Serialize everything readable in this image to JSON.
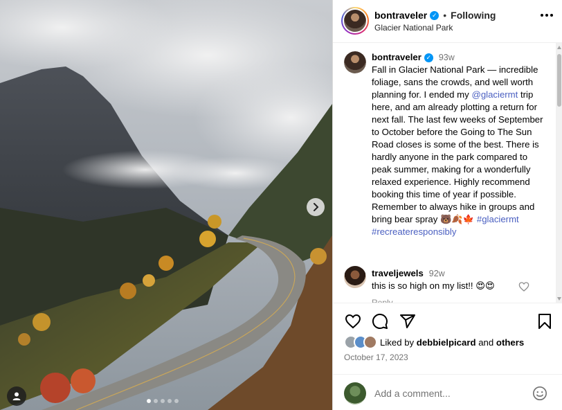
{
  "post": {
    "author": "bontraveler",
    "location": "Glacier National Park",
    "follow_status": "Following",
    "separator": "•",
    "image_slide_count": 5,
    "image_active_slide": 1
  },
  "caption": {
    "username": "bontraveler",
    "time": "93w",
    "text_1": "Fall in Glacier National Park — incredible foliage, sans the crowds, and well worth planning for. I ended my ",
    "mention": "@glaciermt",
    "text_2": " trip here, and am already plotting a return for next fall. The last few weeks of September to October before the Going to The Sun Road closes is some of the best. There is hardly anyone in the park compared to peak summer, making for a wonderfully relaxed experience. Highly recommend booking this time of year if possible. Remember to always hike in groups and bring bear spray 🐻🍂🍁 ",
    "hashtag_1": "#glaciermt",
    "hashtag_2": "#recreateresponsibly"
  },
  "comment": {
    "username": "traveljewels",
    "time": "92w",
    "text": "this is so high on my list!! 😍😍",
    "reply_peek": "Reply"
  },
  "likes": {
    "prefix": "Liked by",
    "name": "debbielpicard",
    "and": "and",
    "others": "others"
  },
  "date": "October 17, 2023",
  "add_comment": {
    "placeholder": "Add a comment..."
  },
  "icons": {
    "like": "heart-icon",
    "comment": "comment-icon",
    "share": "share-icon",
    "save": "bookmark-icon",
    "more": "more-options-icon",
    "emoji": "emoji-icon",
    "next": "chevron-right-icon",
    "tag": "user-tag-icon",
    "verified": "verified-badge-icon"
  },
  "colors": {
    "verified": "#0095f6",
    "link": "#4a5fc1",
    "secondary_text": "#737373"
  }
}
